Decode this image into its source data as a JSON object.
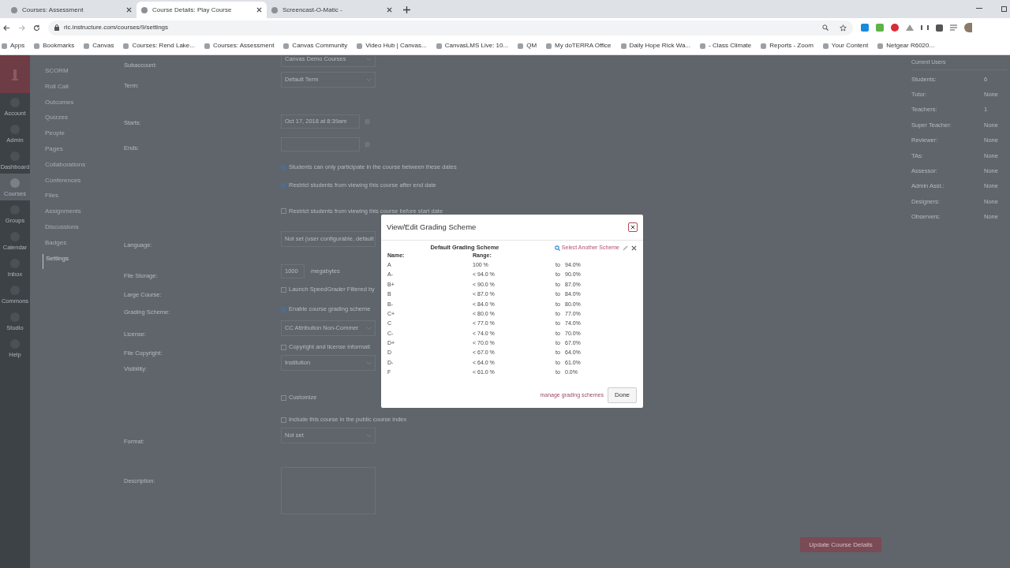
{
  "browser": {
    "tabs": [
      {
        "title": "Courses: Assessment",
        "selected": false
      },
      {
        "title": "Course Details: Play Course",
        "selected": true
      },
      {
        "title": "Screencast-O-Matic -",
        "selected": false
      }
    ],
    "url": "rlc.instructure.com/courses/9/settings",
    "bookmarks": [
      {
        "label": "Apps"
      },
      {
        "label": "Bookmarks"
      },
      {
        "label": "Canvas"
      },
      {
        "label": "Courses: Rend Lake..."
      },
      {
        "label": "Courses: Assessment"
      },
      {
        "label": "Canvas Community"
      },
      {
        "label": "Video Hub | Canvas..."
      },
      {
        "label": "CanvasLMS Live: 10..."
      },
      {
        "label": "QM"
      },
      {
        "label": "My doTERRA Office"
      },
      {
        "label": "Daily Hope Rick Wa..."
      },
      {
        "label": "- Class Climate"
      },
      {
        "label": "Reports - Zoom"
      },
      {
        "label": "Your Content"
      },
      {
        "label": "Netgear R6020..."
      }
    ]
  },
  "global_nav": [
    {
      "label": "Account",
      "selected": false
    },
    {
      "label": "Admin",
      "selected": false
    },
    {
      "label": "Dashboard",
      "selected": false
    },
    {
      "label": "Courses",
      "selected": true
    },
    {
      "label": "Groups",
      "selected": false
    },
    {
      "label": "Calendar",
      "selected": false
    },
    {
      "label": "Inbox",
      "selected": false
    },
    {
      "label": "Commons",
      "selected": false
    },
    {
      "label": "Studio",
      "selected": false
    },
    {
      "label": "Help",
      "selected": false
    }
  ],
  "course_nav": [
    {
      "label": "SCORM",
      "selected": false
    },
    {
      "label": "Roll Call",
      "selected": false
    },
    {
      "label": "Outcomes",
      "selected": false
    },
    {
      "label": "Quizzes",
      "selected": false
    },
    {
      "label": "People",
      "selected": false
    },
    {
      "label": "Pages",
      "selected": false
    },
    {
      "label": "Collaborations",
      "selected": false
    },
    {
      "label": "Conferences",
      "selected": false
    },
    {
      "label": "Files",
      "selected": false
    },
    {
      "label": "Assignments",
      "selected": false
    },
    {
      "label": "Discussions",
      "selected": false
    },
    {
      "label": "Badges",
      "selected": false
    },
    {
      "label": "Settings",
      "selected": true
    }
  ],
  "form": [
    {
      "label": "Subaccount:",
      "kind": "select",
      "value": "Canvas Demo Courses"
    },
    {
      "label": "Term:",
      "kind": "select",
      "value": "Default Term"
    },
    {
      "label": "Starts:",
      "kind": "date",
      "value": "Oct 17, 2018 at 8:39am"
    },
    {
      "label": "Ends:",
      "kind": "date"
    },
    {
      "kind": "checkbox",
      "text": "Students can only participate in the course between these dates",
      "checked": true
    },
    {
      "kind": "checkbox",
      "text": "Restrict students from viewing this course after end date",
      "checked": true
    },
    {
      "kind": "checkbox",
      "text": "Restrict students from viewing this course before start date",
      "checked": false
    },
    {
      "label": "Language:",
      "kind": "select",
      "value": "Not set (user configurable, default"
    },
    {
      "label": "File Storage:",
      "kind": "storage",
      "value": "1000",
      "unit": "megabytes"
    },
    {
      "label": "Large Course:",
      "kind": "checkbox",
      "text": "Launch SpeedGrader Filtered by",
      "checked": false
    },
    {
      "label": "Grading Scheme:",
      "kind": "checkbox",
      "text": "Enable course grading scheme",
      "checked": true
    },
    {
      "label": "License:",
      "kind": "select",
      "value": "CC Attribution Non-Commer"
    },
    {
      "label": "File Copyright:",
      "kind": "checkbox",
      "text": "Copyright and license informati",
      "checked": false
    },
    {
      "label": "Visibility:",
      "kind": "select",
      "value": "Institution"
    },
    {
      "kind": "checkbox",
      "text": "Customize",
      "checked": false
    },
    {
      "kind": "checkbox",
      "text": "Include this course in the public course index",
      "checked": false
    },
    {
      "label": "Format:",
      "kind": "select",
      "value": "Not set"
    },
    {
      "label": "Description:",
      "kind": "textarea"
    }
  ],
  "current_users": {
    "title": "Current Users",
    "rows": [
      {
        "role": "Students:",
        "count": "6"
      },
      {
        "role": "Tutor:",
        "count": "None"
      },
      {
        "role": "Teachers:",
        "count": "1"
      },
      {
        "role": "Super Teacher:",
        "count": "None"
      },
      {
        "role": "Reviewer:",
        "count": "None"
      },
      {
        "role": "TAs:",
        "count": "None"
      },
      {
        "role": "Assessor:",
        "count": "None"
      },
      {
        "role": "Admin Asst.:",
        "count": "None"
      },
      {
        "role": "Designers:",
        "count": "None"
      },
      {
        "role": "Observers:",
        "count": "None"
      }
    ]
  },
  "update_button": "Update Course Details",
  "dialog": {
    "title": "View/Edit Grading Scheme",
    "scheme_name": "Default Grading Scheme",
    "select_link": "Select Another Scheme",
    "name_header": "Name:",
    "range_header": "Range:",
    "rows": [
      {
        "name": "A",
        "upper": "100 %",
        "sep": "to",
        "lower": "94.0%"
      },
      {
        "name": "A-",
        "upper": "< 94.0 %",
        "sep": "to",
        "lower": "90.0%"
      },
      {
        "name": "B+",
        "upper": "< 90.0 %",
        "sep": "to",
        "lower": "87.0%"
      },
      {
        "name": "B",
        "upper": "< 87.0 %",
        "sep": "to",
        "lower": "84.0%"
      },
      {
        "name": "B-",
        "upper": "< 84.0 %",
        "sep": "to",
        "lower": "80.0%"
      },
      {
        "name": "C+",
        "upper": "< 80.0 %",
        "sep": "to",
        "lower": "77.0%"
      },
      {
        "name": "C",
        "upper": "< 77.0 %",
        "sep": "to",
        "lower": "74.0%"
      },
      {
        "name": "C-",
        "upper": "< 74.0 %",
        "sep": "to",
        "lower": "70.0%"
      },
      {
        "name": "D+",
        "upper": "< 70.0 %",
        "sep": "to",
        "lower": "67.0%"
      },
      {
        "name": "D",
        "upper": "< 67.0 %",
        "sep": "to",
        "lower": "64.0%"
      },
      {
        "name": "D-",
        "upper": "< 64.0 %",
        "sep": "to",
        "lower": "61.0%"
      },
      {
        "name": "F",
        "upper": "< 61.0 %",
        "sep": "to",
        "lower": "0.0%"
      }
    ],
    "manage_link": "manage grading schemes",
    "done": "Done"
  }
}
